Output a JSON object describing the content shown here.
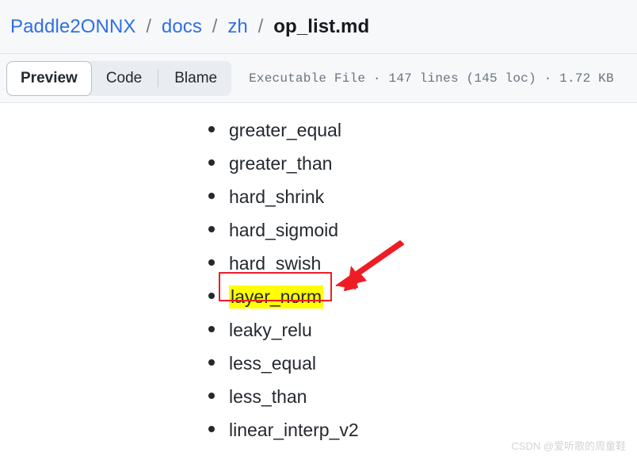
{
  "header": {
    "breadcrumb": {
      "repo": "Paddle2ONNX",
      "folder1": "docs",
      "folder2": "zh",
      "file": "op_list.md",
      "separator": "/"
    }
  },
  "viewbar": {
    "tabs": [
      {
        "label": "Preview",
        "selected": true
      },
      {
        "label": "Code",
        "selected": false
      },
      {
        "label": "Blame",
        "selected": false
      }
    ],
    "file_meta": "Executable File · 147 lines (145 loc) · 1.72 KB"
  },
  "content": {
    "list_items": [
      {
        "name": "greater_equal",
        "highlighted": false
      },
      {
        "name": "greater_than",
        "highlighted": false
      },
      {
        "name": "hard_shrink",
        "highlighted": false
      },
      {
        "name": "hard_sigmoid",
        "highlighted": false
      },
      {
        "name": "hard_swish",
        "highlighted": false
      },
      {
        "name": "layer_norm",
        "highlighted": true
      },
      {
        "name": "leaky_relu",
        "highlighted": false
      },
      {
        "name": "less_equal",
        "highlighted": false
      },
      {
        "name": "less_than",
        "highlighted": false
      },
      {
        "name": "linear_interp_v2",
        "highlighted": false
      }
    ]
  },
  "annotations": {
    "highlight_color": "#ffff00",
    "box_color": "#ee1c25",
    "arrow_color": "#ee1c25",
    "target": "layer_norm"
  },
  "watermark": {
    "text": "CSDN @爱听歌的周童鞋"
  },
  "colors": {
    "link": "#2f6fe4",
    "header_bg": "#f6f8fa",
    "tabgroup_bg": "#e9ecf0",
    "text": "#24292f"
  }
}
